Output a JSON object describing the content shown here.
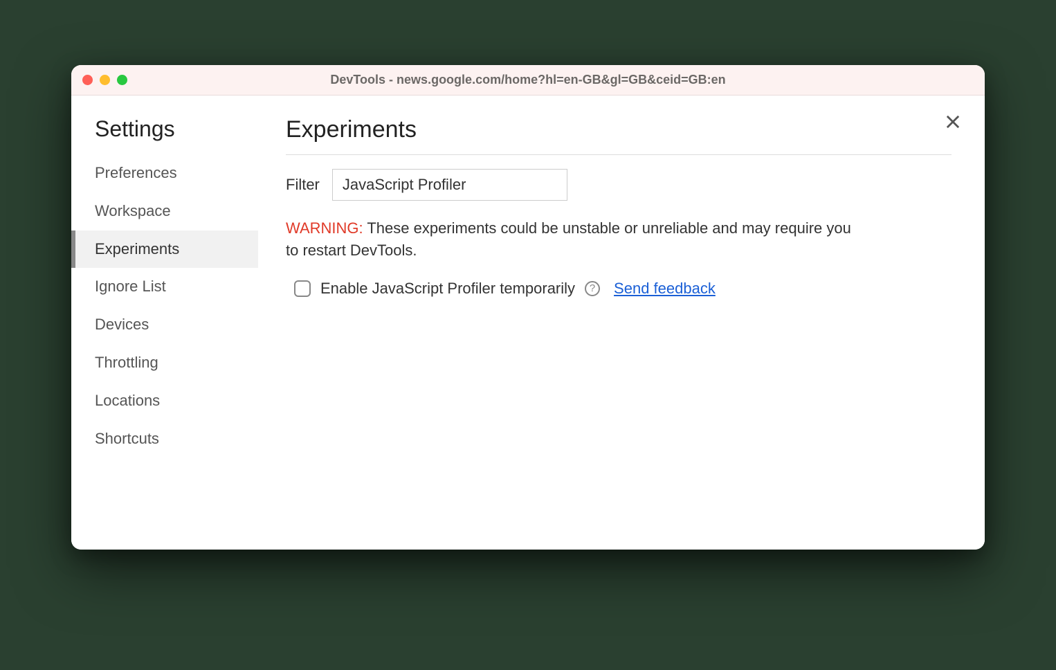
{
  "window": {
    "title": "DevTools - news.google.com/home?hl=en-GB&gl=GB&ceid=GB:en"
  },
  "sidebar": {
    "title": "Settings",
    "items": [
      {
        "label": "Preferences",
        "active": false
      },
      {
        "label": "Workspace",
        "active": false
      },
      {
        "label": "Experiments",
        "active": true
      },
      {
        "label": "Ignore List",
        "active": false
      },
      {
        "label": "Devices",
        "active": false
      },
      {
        "label": "Throttling",
        "active": false
      },
      {
        "label": "Locations",
        "active": false
      },
      {
        "label": "Shortcuts",
        "active": false
      }
    ]
  },
  "main": {
    "title": "Experiments",
    "filter_label": "Filter",
    "filter_value": "JavaScript Profiler",
    "warning_label": "WARNING:",
    "warning_text": " These experiments could be unstable or unreliable and may require you to restart DevTools.",
    "experiment_label": "Enable JavaScript Profiler temporarily",
    "help_char": "?",
    "feedback_label": "Send feedback"
  }
}
